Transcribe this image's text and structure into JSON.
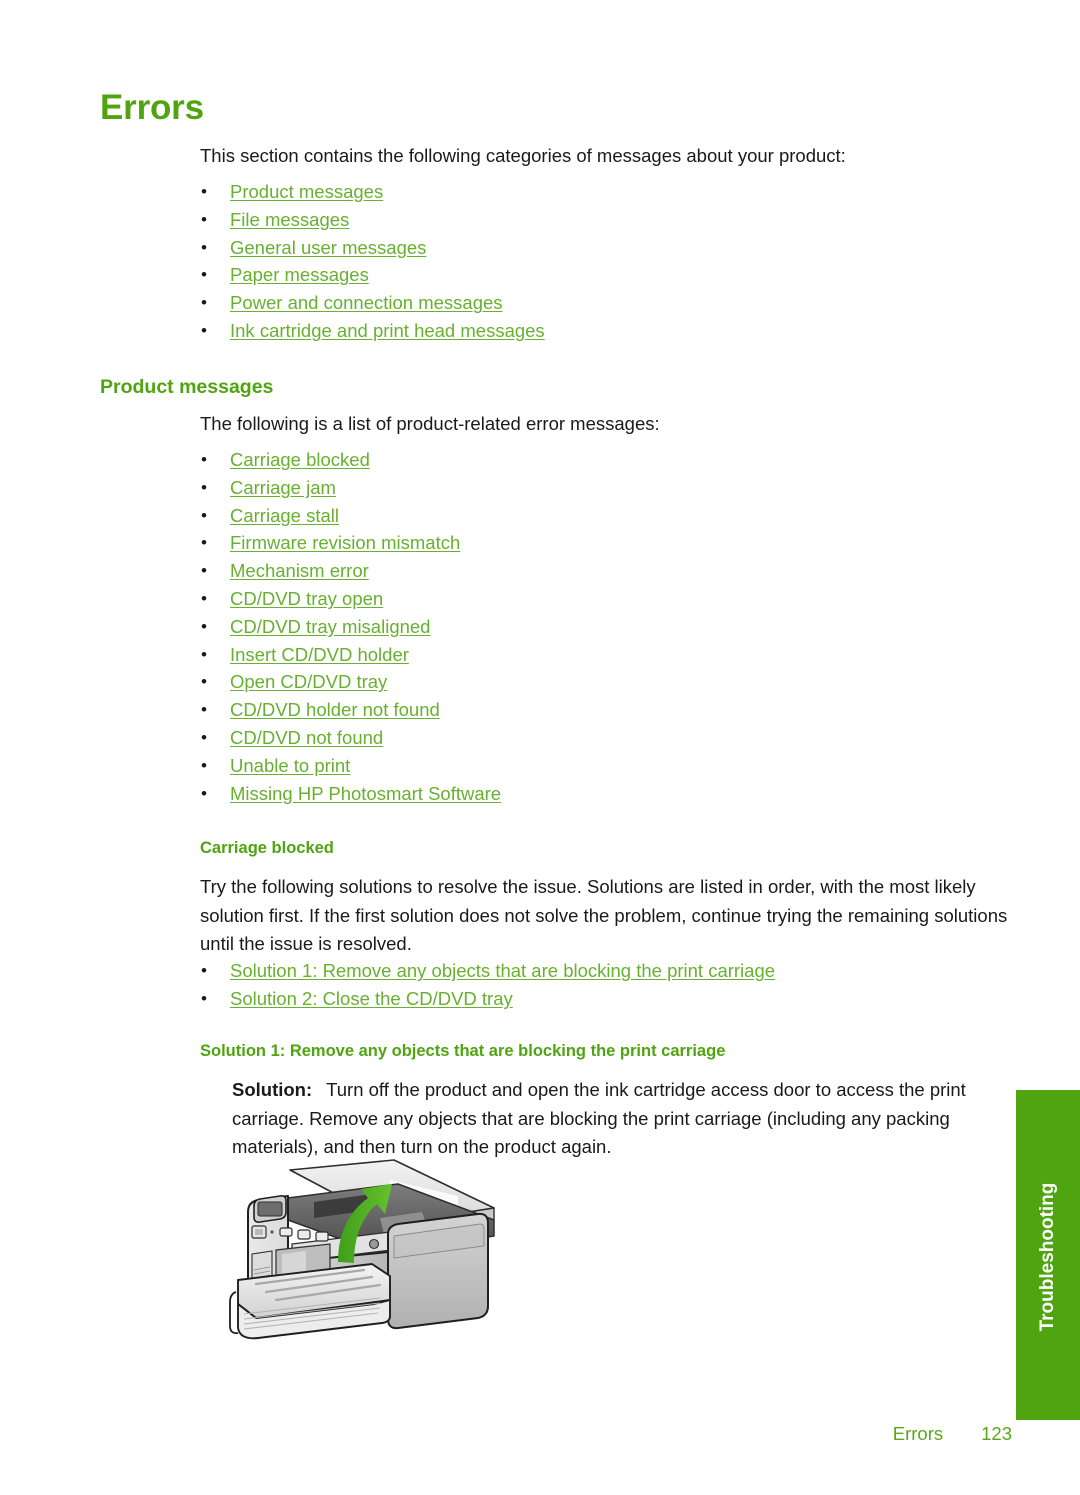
{
  "page": {
    "heading": "Errors",
    "intro": "This section contains the following categories of messages about your product:",
    "footer_section": "Errors",
    "footer_page_number": "123",
    "side_tab_label": "Troubleshooting",
    "accent_green": "#4fa410",
    "link_green": "#68b030"
  },
  "category_links": [
    {
      "label": "Product messages"
    },
    {
      "label": "File messages"
    },
    {
      "label": "General user messages"
    },
    {
      "label": "Paper messages"
    },
    {
      "label": "Power and connection messages"
    },
    {
      "label": "Ink cartridge and print head messages"
    }
  ],
  "product_messages": {
    "heading": "Product messages",
    "intro": "The following is a list of product-related error messages:",
    "links": [
      {
        "label": "Carriage blocked"
      },
      {
        "label": "Carriage jam"
      },
      {
        "label": "Carriage stall"
      },
      {
        "label": "Firmware revision mismatch"
      },
      {
        "label": "Mechanism error"
      },
      {
        "label": "CD/DVD tray open"
      },
      {
        "label": "CD/DVD tray misaligned"
      },
      {
        "label": "Insert CD/DVD holder"
      },
      {
        "label": "Open CD/DVD tray"
      },
      {
        "label": "CD/DVD holder not found"
      },
      {
        "label": "CD/DVD not found"
      },
      {
        "label": "Unable to print"
      },
      {
        "label": "Missing HP Photosmart Software"
      }
    ]
  },
  "carriage_blocked": {
    "heading": "Carriage blocked",
    "paragraph": "Try the following solutions to resolve the issue. Solutions are listed in order, with the most likely solution first. If the first solution does not solve the problem, continue trying the remaining solutions until the issue is resolved.",
    "links": [
      {
        "label": "Solution 1: Remove any objects that are blocking the print carriage"
      },
      {
        "label": "Solution 2: Close the CD/DVD tray"
      }
    ]
  },
  "solution_1": {
    "heading": "Solution 1: Remove any objects that are blocking the print carriage",
    "label": "Solution:",
    "body": "Turn off the product and open the ink cartridge access door to access the print carriage. Remove any objects that are blocking the print carriage (including any packing materials), and then turn on the product again."
  }
}
